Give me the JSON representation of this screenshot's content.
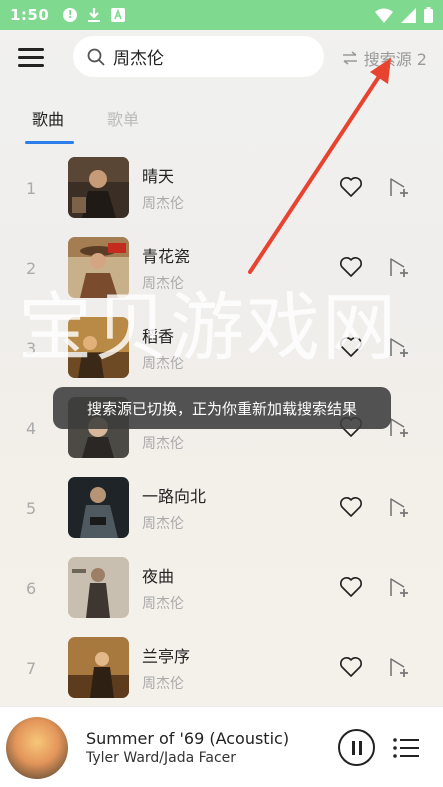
{
  "status_bar": {
    "time": "1:50"
  },
  "header": {
    "search_query": "周杰伦",
    "source_label": "搜索源 2"
  },
  "tabs": [
    {
      "label": "歌曲",
      "active": true
    },
    {
      "label": "歌单",
      "active": false
    }
  ],
  "songs": [
    {
      "index": "1",
      "title": "晴天",
      "artist": "周杰伦"
    },
    {
      "index": "2",
      "title": "青花瓷",
      "artist": "周杰伦"
    },
    {
      "index": "3",
      "title": "稻香",
      "artist": "周杰伦"
    },
    {
      "index": "4",
      "title": "",
      "artist": "周杰伦"
    },
    {
      "index": "5",
      "title": "一路向北",
      "artist": "周杰伦"
    },
    {
      "index": "6",
      "title": "夜曲",
      "artist": "周杰伦"
    },
    {
      "index": "7",
      "title": "兰亭序",
      "artist": "周杰伦"
    }
  ],
  "toast": "搜索源已切换，正为你重新加载搜索结果",
  "watermark": "宝贝游戏网",
  "player": {
    "title": "Summer of '69 (Acoustic)",
    "artist": "Tyler Ward/Jada Facer"
  },
  "colors": {
    "status_bar": "#7fd98f",
    "accent": "#2b7de9",
    "arrow": "#e8432f"
  }
}
